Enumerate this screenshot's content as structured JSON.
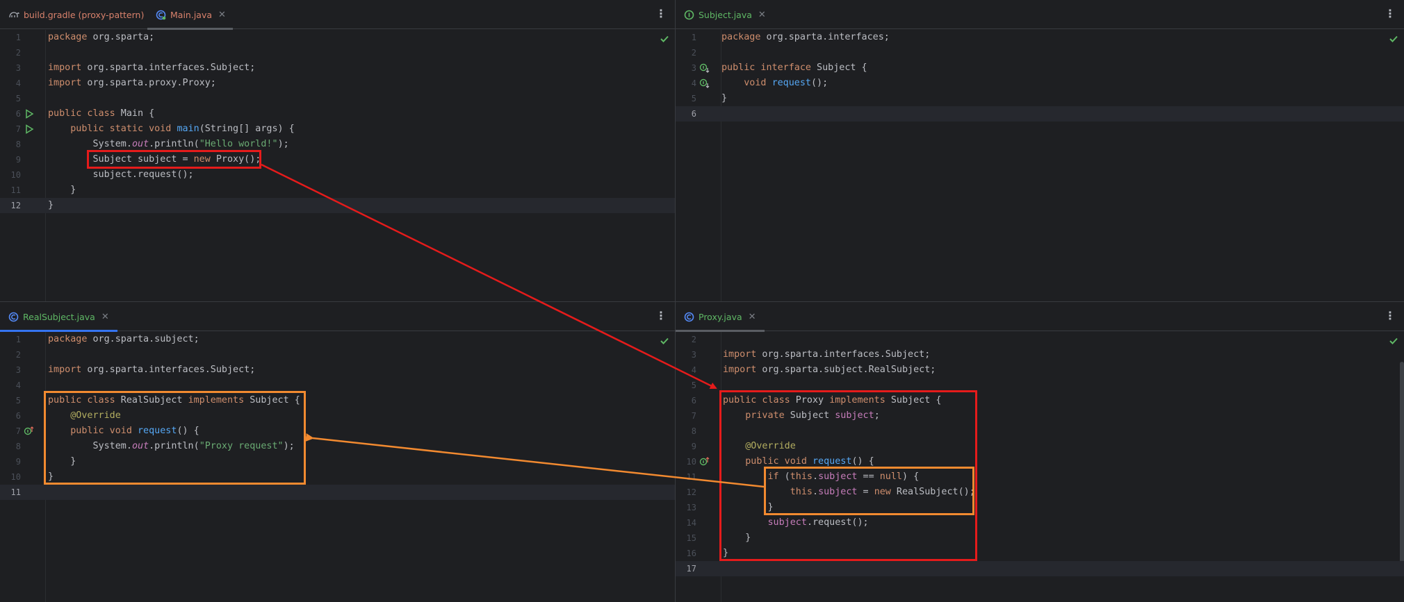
{
  "panes": {
    "main": {
      "tabs": [
        {
          "label": "build.gradle (proxy-pattern)",
          "icon": "gradle-icon",
          "color": "#d9826c"
        },
        {
          "label": "Main.java",
          "icon": "java-class-icon",
          "color": "#d9826c",
          "active": true
        }
      ],
      "lines": [
        {
          "n": "1",
          "code": "package org.sparta;"
        },
        {
          "n": "2",
          "code": ""
        },
        {
          "n": "3",
          "code": "import org.sparta.interfaces.Subject;"
        },
        {
          "n": "4",
          "code": "import org.sparta.proxy.Proxy;"
        },
        {
          "n": "5",
          "code": ""
        },
        {
          "n": "6",
          "code": "public class Main {"
        },
        {
          "n": "7",
          "code": "    public static void main(String[] args) {"
        },
        {
          "n": "8",
          "code": "        System.out.println(\"Hello world!\");"
        },
        {
          "n": "9",
          "code": "        Subject subject = new Proxy();"
        },
        {
          "n": "10",
          "code": "        subject.request();"
        },
        {
          "n": "11",
          "code": "    }"
        },
        {
          "n": "12",
          "code": "}"
        }
      ]
    },
    "subject": {
      "tabs": [
        {
          "label": "Subject.java",
          "icon": "java-interface-icon",
          "color": "#5fb865",
          "active": true
        }
      ],
      "lines": [
        {
          "n": "1",
          "code": "package org.sparta.interfaces;"
        },
        {
          "n": "2",
          "code": ""
        },
        {
          "n": "3",
          "code": "public interface Subject {"
        },
        {
          "n": "4",
          "code": "    void request();"
        },
        {
          "n": "5",
          "code": "}"
        },
        {
          "n": "6",
          "code": ""
        }
      ]
    },
    "realsubject": {
      "tabs": [
        {
          "label": "RealSubject.java",
          "icon": "java-class-icon",
          "color": "#5fb865",
          "active": true
        }
      ],
      "lines": [
        {
          "n": "1",
          "code": "package org.sparta.subject;"
        },
        {
          "n": "2",
          "code": ""
        },
        {
          "n": "3",
          "code": "import org.sparta.interfaces.Subject;"
        },
        {
          "n": "4",
          "code": ""
        },
        {
          "n": "5",
          "code": "public class RealSubject implements Subject {"
        },
        {
          "n": "6",
          "code": "    @Override"
        },
        {
          "n": "7",
          "code": "    public void request() {"
        },
        {
          "n": "8",
          "code": "        System.out.println(\"Proxy request\");"
        },
        {
          "n": "9",
          "code": "    }"
        },
        {
          "n": "10",
          "code": "}"
        },
        {
          "n": "11",
          "code": ""
        }
      ]
    },
    "proxy": {
      "tabs": [
        {
          "label": "Proxy.java",
          "icon": "java-class-icon",
          "color": "#5fb865",
          "active": true
        }
      ],
      "lines": [
        {
          "n": "2",
          "code": ""
        },
        {
          "n": "3",
          "code": "import org.sparta.interfaces.Subject;"
        },
        {
          "n": "4",
          "code": "import org.sparta.subject.RealSubject;"
        },
        {
          "n": "5",
          "code": ""
        },
        {
          "n": "6",
          "code": "public class Proxy implements Subject {"
        },
        {
          "n": "7",
          "code": "    private Subject subject;"
        },
        {
          "n": "8",
          "code": ""
        },
        {
          "n": "9",
          "code": "    @Override"
        },
        {
          "n": "10",
          "code": "    public void request() {"
        },
        {
          "n": "11",
          "code": "        if (this.subject == null) {"
        },
        {
          "n": "12",
          "code": "            this.subject = new RealSubject();"
        },
        {
          "n": "13",
          "code": "        }"
        },
        {
          "n": "14",
          "code": "        subject.request();"
        },
        {
          "n": "15",
          "code": "    }"
        },
        {
          "n": "16",
          "code": "}"
        },
        {
          "n": "17",
          "code": ""
        }
      ]
    }
  },
  "annotation_colors": {
    "red": "#e51b1b",
    "orange": "#f28a30"
  },
  "icons": {
    "more": "more-vertical-icon",
    "close": "close-icon",
    "run": "run-gutter-icon",
    "implemented": "implemented-icon",
    "implementing": "implementing-icon",
    "analysis_ok": "check-icon"
  }
}
